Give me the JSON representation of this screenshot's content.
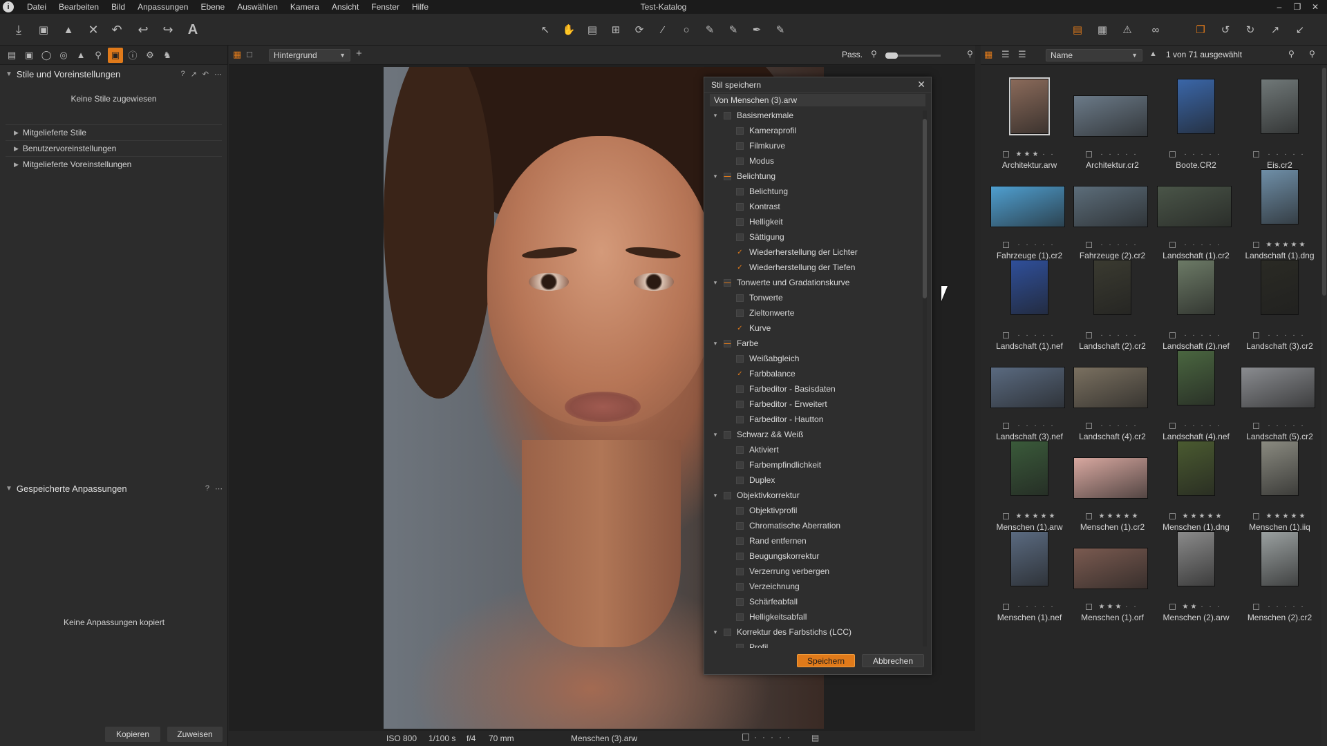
{
  "window": {
    "title": "Test-Katalog"
  },
  "menu": [
    "Datei",
    "Bearbeiten",
    "Bild",
    "Anpassungen",
    "Ebene",
    "Auswählen",
    "Kamera",
    "Ansicht",
    "Fenster",
    "Hilfe"
  ],
  "left_panel": {
    "styles_title": "Stile und Voreinstellungen",
    "no_styles": "Keine Stile zugewiesen",
    "tree": [
      "Mitgelieferte Stile",
      "Benutzervoreinstellungen",
      "Mitgelieferte Voreinstellungen"
    ],
    "saved_title": "Gespeicherte Anpassungen",
    "no_adjustments": "Keine Anpassungen kopiert",
    "copy_label": "Kopieren",
    "apply_label": "Zuweisen"
  },
  "viewer": {
    "layer_select": "Hintergrund",
    "fit_label": "Pass.",
    "status": {
      "iso": "ISO 800",
      "shutter": "1/100 s",
      "aperture": "f/4",
      "focal": "70 mm",
      "filename": "Menschen (3).arw"
    }
  },
  "dialog": {
    "title": "Stil speichern",
    "source": "Von Menschen (3).arw",
    "save_label": "Speichern",
    "cancel_label": "Abbrechen",
    "groups": [
      {
        "label": "Basismerkmale",
        "state": "none",
        "items": [
          {
            "label": "Kameraprofil",
            "checked": false
          },
          {
            "label": "Filmkurve",
            "checked": false
          },
          {
            "label": "Modus",
            "checked": false
          }
        ]
      },
      {
        "label": "Belichtung",
        "state": "partial",
        "items": [
          {
            "label": "Belichtung",
            "checked": false
          },
          {
            "label": "Kontrast",
            "checked": false
          },
          {
            "label": "Helligkeit",
            "checked": false
          },
          {
            "label": "Sättigung",
            "checked": false
          },
          {
            "label": "Wiederherstellung der Lichter",
            "checked": true
          },
          {
            "label": "Wiederherstellung der Tiefen",
            "checked": true
          }
        ]
      },
      {
        "label": "Tonwerte und Gradationskurve",
        "state": "partial",
        "items": [
          {
            "label": "Tonwerte",
            "checked": false
          },
          {
            "label": "Zieltonwerte",
            "checked": false
          },
          {
            "label": "Kurve",
            "checked": true
          }
        ]
      },
      {
        "label": "Farbe",
        "state": "partial",
        "items": [
          {
            "label": "Weißabgleich",
            "checked": false
          },
          {
            "label": "Farbbalance",
            "checked": true
          },
          {
            "label": "Farbeditor - Basisdaten",
            "checked": false
          },
          {
            "label": "Farbeditor - Erweitert",
            "checked": false
          },
          {
            "label": "Farbeditor - Hautton",
            "checked": false
          }
        ]
      },
      {
        "label": "Schwarz && Weiß",
        "state": "none",
        "items": [
          {
            "label": "Aktiviert",
            "checked": false
          },
          {
            "label": "Farbempfindlichkeit",
            "checked": false
          },
          {
            "label": "Duplex",
            "checked": false
          }
        ]
      },
      {
        "label": "Objektivkorrektur",
        "state": "none",
        "items": [
          {
            "label": "Objektivprofil",
            "checked": false
          },
          {
            "label": "Chromatische Aberration",
            "checked": false
          },
          {
            "label": "Rand entfernen",
            "checked": false
          },
          {
            "label": "Beugungskorrektur",
            "checked": false
          },
          {
            "label": "Verzerrung verbergen",
            "checked": false
          },
          {
            "label": "Verzeichnung",
            "checked": false
          },
          {
            "label": "Schärfeabfall",
            "checked": false
          },
          {
            "label": "Helligkeitsabfall",
            "checked": false
          }
        ]
      },
      {
        "label": "Korrektur des Farbstichs (LCC)",
        "state": "none",
        "items": [
          {
            "label": "Profil",
            "checked": false
          }
        ]
      }
    ]
  },
  "browser": {
    "sort_select": "Name",
    "selection_count": "1 von 71 ausgewählt",
    "images": [
      {
        "name": "Architektur.arw",
        "stars": 3,
        "color": "#8a6a5a",
        "portrait": true
      },
      {
        "name": "Architektur.cr2",
        "stars": 0,
        "color": "#6b7a88",
        "portrait": false
      },
      {
        "name": "Boote.CR2",
        "stars": 0,
        "color": "#3a66a8",
        "portrait": true
      },
      {
        "name": "Eis.cr2",
        "stars": 0,
        "color": "#707878",
        "portrait": true
      },
      {
        "name": "Fahrzeuge (1).cr2",
        "stars": 0,
        "color": "#4f9fd0",
        "portrait": false
      },
      {
        "name": "Fahrzeuge (2).cr2",
        "stars": 0,
        "color": "#5c6d7a",
        "portrait": false
      },
      {
        "name": "Landschaft (1).cr2",
        "stars": 0,
        "color": "#4a5548",
        "portrait": false
      },
      {
        "name": "Landschaft (1).dng",
        "stars": 5,
        "color": "#6f8fa8",
        "portrait": true
      },
      {
        "name": "Landschaft (1).nef",
        "stars": 0,
        "color": "#2f4f9a",
        "portrait": true
      },
      {
        "name": "Landschaft (2).cr2",
        "stars": 0,
        "color": "#3a3a30",
        "portrait": true
      },
      {
        "name": "Landschaft (2).nef",
        "stars": 0,
        "color": "#6c7a66",
        "portrait": true
      },
      {
        "name": "Landschaft (3).cr2",
        "stars": 0,
        "color": "#2a2a24",
        "portrait": true
      },
      {
        "name": "Landschaft (3).nef",
        "stars": 0,
        "color": "#5a6a80",
        "portrait": false
      },
      {
        "name": "Landschaft (4).cr2",
        "stars": 0,
        "color": "#7a7060",
        "portrait": false
      },
      {
        "name": "Landschaft (4).nef",
        "stars": 0,
        "color": "#4a6640",
        "portrait": true
      },
      {
        "name": "Landschaft (5).cr2",
        "stars": 0,
        "color": "#8a8c90",
        "portrait": false
      },
      {
        "name": "Menschen (1).arw",
        "stars": 5,
        "color": "#3a5a3a",
        "portrait": true
      },
      {
        "name": "Menschen (1).cr2",
        "stars": 5,
        "color": "#d8a8a0",
        "portrait": false
      },
      {
        "name": "Menschen (1).dng",
        "stars": 5,
        "color": "#4a5a30",
        "portrait": true
      },
      {
        "name": "Menschen (1).iiq",
        "stars": 5,
        "color": "#8a8a80",
        "portrait": true
      },
      {
        "name": "Menschen (1).nef",
        "stars": 0,
        "color": "#5a6a80",
        "portrait": true
      },
      {
        "name": "Menschen (1).orf",
        "stars": 3,
        "color": "#7a5a50",
        "portrait": false
      },
      {
        "name": "Menschen (2).arw",
        "stars": 2,
        "color": "#8a8a8a",
        "portrait": true
      },
      {
        "name": "Menschen (2).cr2",
        "stars": 0,
        "color": "#9aa0a0",
        "portrait": true
      }
    ]
  }
}
